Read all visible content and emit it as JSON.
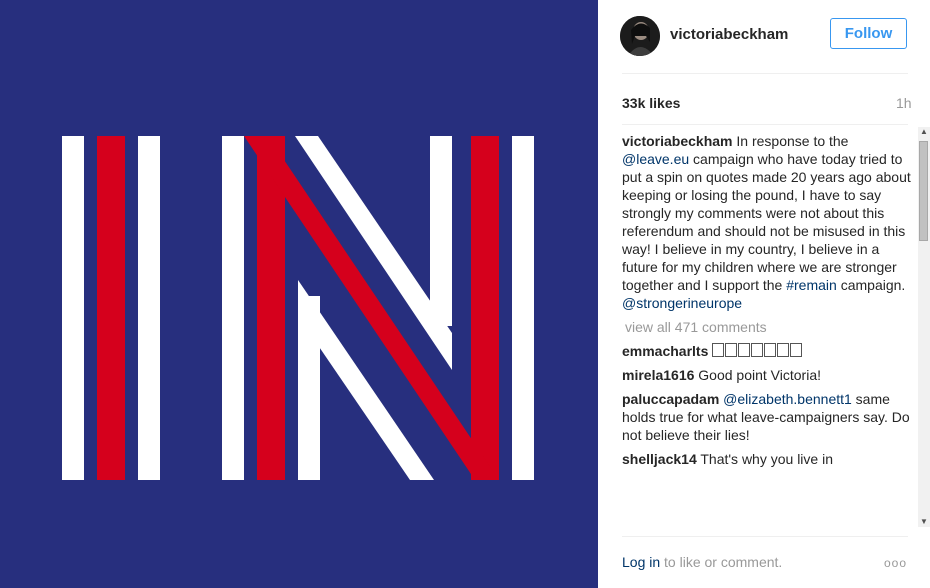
{
  "post": {
    "image": {
      "description_icon": "in-logo",
      "colors": {
        "background": "#272f7e",
        "red": "#d5001c",
        "white": "#ffffff"
      }
    },
    "header": {
      "username": "victoriabeckham",
      "follow_label": "Follow"
    },
    "likes": "33k likes",
    "time": "1h",
    "caption": {
      "username": "victoriabeckham",
      "text_1": "In response to the ",
      "mention_1": "@leave.eu",
      "text_2": " campaign who have today tried to put a spin on quotes made 20 years ago about keeping or losing the pound, I have to say strongly my comments were not about this referendum and should not be misused in this way! I believe in my country, I believe in a future for my children where we are stronger together and I support the ",
      "hashtag": "#remain",
      "text_3": " campaign. ",
      "mention_2": "@strongerineurope"
    },
    "view_all": "view all 471 comments",
    "comments": [
      {
        "username": "emmacharlts",
        "text": ""
      },
      {
        "username": "mirela1616",
        "text": "Good point Victoria!"
      },
      {
        "username": "paluccapadam",
        "mention": "@elizabeth.bennett1",
        "text": " same holds true for what leave-campaigners say. Do not believe their lies!"
      },
      {
        "username": "shelljack14",
        "text": "That's why you live in"
      }
    ],
    "footer": {
      "login": "Log in",
      "rest": " to like or comment.",
      "more": "ooo"
    }
  }
}
